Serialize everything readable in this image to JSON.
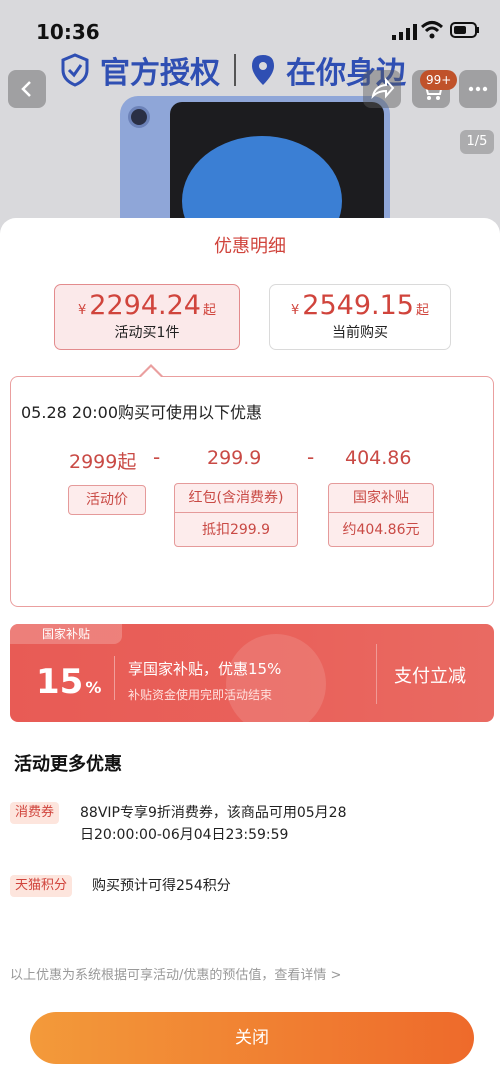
{
  "status": {
    "time": "10:36"
  },
  "banner": {
    "left": "官方授权",
    "right": "在你身边"
  },
  "topbar": {
    "cart_badge": "99+",
    "page_indicator": "1/5"
  },
  "sheet": {
    "title": "优惠明细",
    "options": [
      {
        "currency": "¥",
        "price": "2294.24",
        "suffix": "起",
        "label": "活动买1件",
        "selected": true
      },
      {
        "currency": "¥",
        "price": "2549.15",
        "suffix": "起",
        "label": "当前购买",
        "selected": false
      }
    ],
    "detail": {
      "title": "05.28 20:00购买可使用以下优惠",
      "items": [
        {
          "value": "2999起",
          "tag": "活动价",
          "sub": ""
        },
        {
          "value": "299.9",
          "tag": "红包(含消费券)",
          "sub": "抵扣299.9"
        },
        {
          "value": "404.86",
          "tag": "国家补贴",
          "sub": "约404.86元"
        }
      ],
      "operators": [
        "-",
        "-"
      ]
    },
    "subsidy": {
      "tag": "国家补贴",
      "percent": "15",
      "percent_unit": "%",
      "main": "享国家补贴，优惠15%",
      "note": "补贴资金使用完即活动结束",
      "action": "支付立减"
    },
    "more": {
      "title": "活动更多优惠",
      "items": [
        {
          "tag": "消费券",
          "lines": [
            "88VIP专享9折消费券，该商品可用05月28",
            "日20:00:00-06月04日23:59:59"
          ]
        },
        {
          "tag": "天猫积分",
          "lines": [
            "购买预计可得254积分"
          ]
        }
      ]
    },
    "footnote": "以上优惠为系统根据可享活动/优惠的预估值，查看详情 >",
    "close_label": "关闭"
  }
}
